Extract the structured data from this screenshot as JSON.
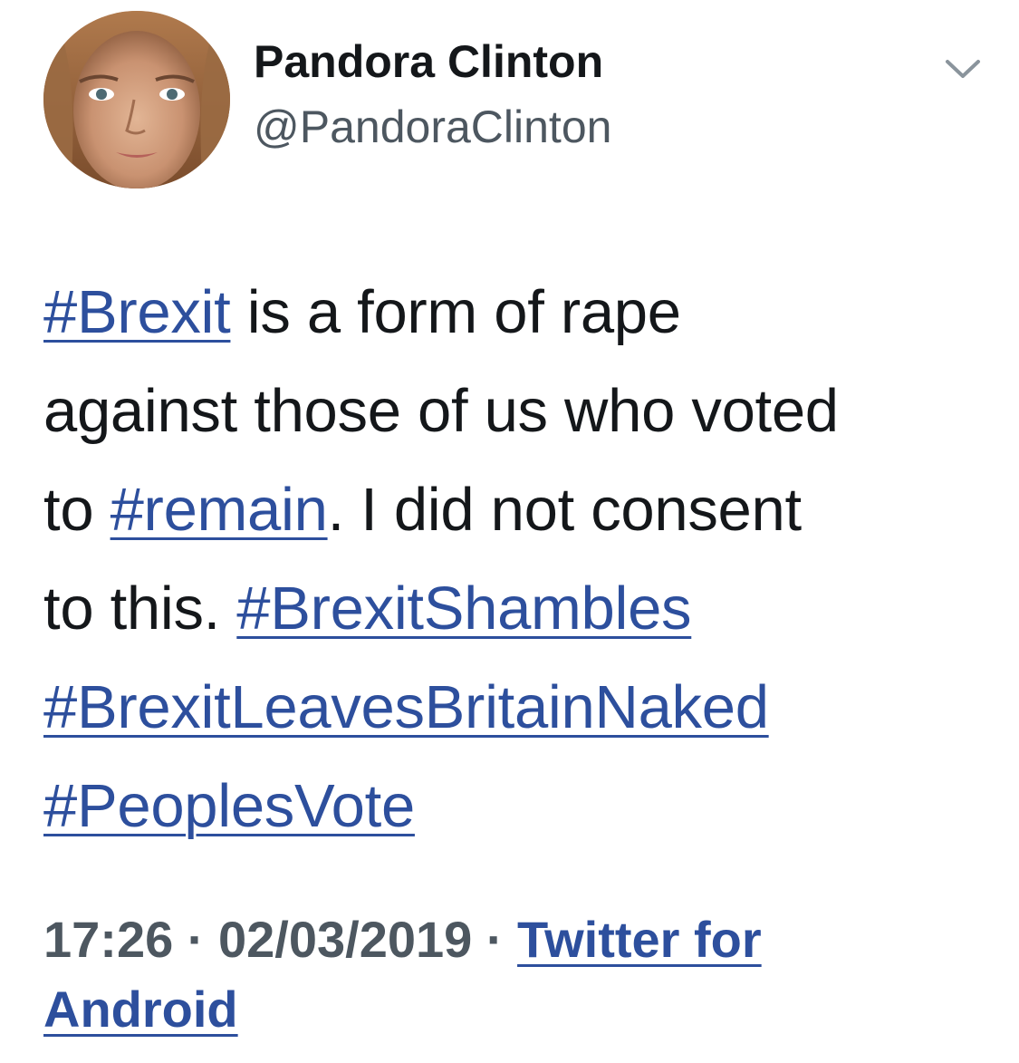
{
  "author": {
    "name": "Pandora Clinton",
    "handle": "@PandoraClinton"
  },
  "tweet": {
    "lines": [
      [
        {
          "type": "hashtag",
          "text": "#Brexit"
        },
        {
          "type": "text",
          "text": " is a form of rape"
        }
      ],
      [
        {
          "type": "text",
          "text": "against those of us who voted"
        }
      ],
      [
        {
          "type": "text",
          "text": "to "
        },
        {
          "type": "hashtag",
          "text": "#remain"
        },
        {
          "type": "text",
          "text": ". I did not consent"
        }
      ],
      [
        {
          "type": "text",
          "text": "to this. "
        },
        {
          "type": "hashtag",
          "text": "#BrexitShambles"
        }
      ],
      [
        {
          "type": "hashtag",
          "text": "#BrexitLeavesBritainNaked"
        }
      ],
      [
        {
          "type": "hashtag",
          "text": "#PeoplesVote"
        }
      ]
    ]
  },
  "meta": {
    "time": "17:26",
    "separator": " · ",
    "date": "02/03/2019",
    "source_line1": "Twitter for",
    "source_line2": "Android"
  },
  "icons": {
    "menu": "chevron-down-icon"
  },
  "colors": {
    "text": "#14171a",
    "secondary": "#4d5760",
    "link": "#2d4f9d"
  }
}
